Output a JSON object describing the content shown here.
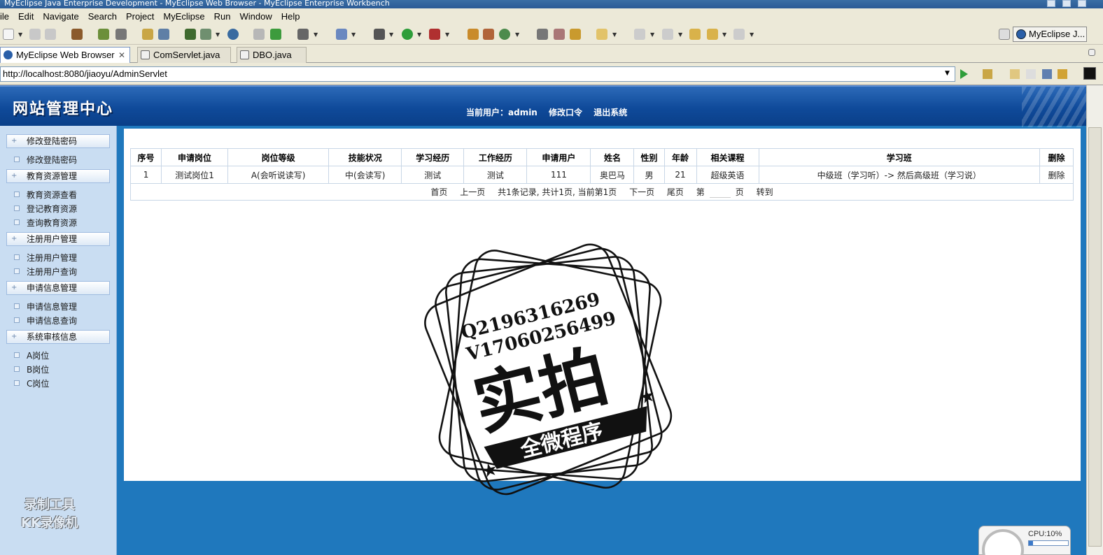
{
  "window": {
    "title": "MyEclipse Java Enterprise Development - MyEclipse Web Browser - MyEclipse Enterprise Workbench"
  },
  "menubar": [
    "ile",
    "Edit",
    "Navigate",
    "Search",
    "Project",
    "MyEclipse",
    "Run",
    "Window",
    "Help"
  ],
  "toolbar": {
    "perspective_label": "MyEclipse J..."
  },
  "tabs": [
    {
      "label": "MyEclipse Web Browser",
      "close": "✕",
      "active": true
    },
    {
      "label": "ComServlet.java",
      "active": false
    },
    {
      "label": "DBO.java",
      "active": false
    }
  ],
  "address": {
    "url": "http://localhost:8080/jiaoyu/AdminServlet"
  },
  "site": {
    "title": "网站管理中心",
    "current_user": "当前用户：admin",
    "change_password": "修改口令",
    "logout": "退出系统"
  },
  "sidebar": {
    "groups": [
      {
        "head": "修改登陆密码",
        "items": [
          "修改登陆密码"
        ]
      },
      {
        "head": "教育资源管理",
        "items": [
          "教育资源查看",
          "登记教育资源",
          "查询教育资源"
        ]
      },
      {
        "head": "注册用户管理",
        "items": [
          "注册用户管理",
          "注册用户查询"
        ]
      },
      {
        "head": "申请信息管理",
        "items": [
          "申请信息管理",
          "申请信息查询"
        ]
      },
      {
        "head": "系统审核信息",
        "items": [
          "A岗位",
          "B岗位",
          "C岗位"
        ]
      }
    ]
  },
  "watermark_recorder": {
    "line1": "录制工具",
    "line2": "KK录像机"
  },
  "table": {
    "headers": [
      "序号",
      "申请岗位",
      "岗位等级",
      "技能状况",
      "学习经历",
      "工作经历",
      "申请用户",
      "姓名",
      "性别",
      "年龄",
      "相关课程",
      "学习班",
      "删除"
    ],
    "rows": [
      [
        "1",
        "测试岗位1",
        "A(会听说读写)",
        "中(会读写)",
        "测试",
        "测试",
        "111",
        "奥巴马",
        "男",
        "21",
        "超级英语",
        "中级班（学习听）-> 然后高级班（学习说）",
        "删除"
      ]
    ],
    "pager": {
      "first": "首页",
      "prev": "上一页",
      "summary": "共1条记录, 共计1页, 当前第1页",
      "next": "下一页",
      "last": "尾页",
      "goto_prefix": "第",
      "goto_suffix": "页",
      "goto": "转到"
    }
  },
  "stamp": {
    "qq": "Q2196316269",
    "wechat": "V17060256499",
    "main": "实拍",
    "banner": "全微程序"
  },
  "cpu": {
    "label": "CPU:10%",
    "percent": 10
  }
}
